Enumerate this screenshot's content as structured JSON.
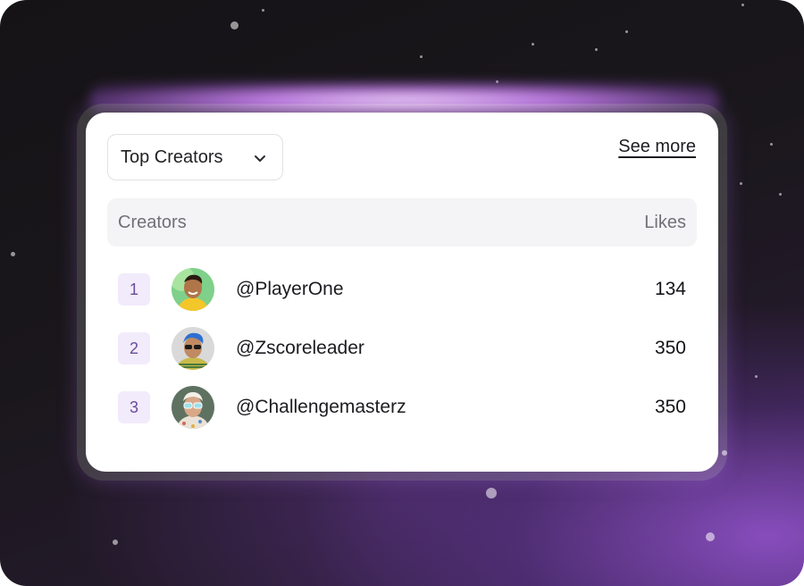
{
  "widget": {
    "dropdown": {
      "selected": "Top Creators",
      "icon": "chevron-down-icon"
    },
    "see_more_label": "See more",
    "table": {
      "columns": {
        "creators": "Creators",
        "likes": "Likes"
      },
      "rows": [
        {
          "rank": "1",
          "handle": "@PlayerOne",
          "likes": "134",
          "avatar_bg": "#7fd08a"
        },
        {
          "rank": "2",
          "handle": "@Zscoreleader",
          "likes": "350",
          "avatar_bg": "#d9d9d9"
        },
        {
          "rank": "3",
          "handle": "@Challengemasterz",
          "likes": "350",
          "avatar_bg": "#5f7262"
        }
      ]
    }
  },
  "colors": {
    "accent_purple": "#a874e8",
    "rank_badge_bg": "#f2ebfb",
    "rank_text": "#6a4c9b",
    "header_bg": "#f4f4f6"
  }
}
